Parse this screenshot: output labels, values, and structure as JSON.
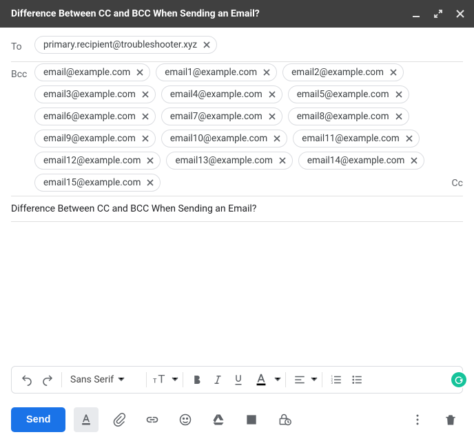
{
  "window": {
    "title": "Difference Between CC and BCC When Sending an Email?"
  },
  "to": {
    "label": "To",
    "recipients": [
      "primary.recipient@troubleshooter.xyz"
    ]
  },
  "bcc": {
    "label": "Bcc",
    "recipients": [
      "email@example.com",
      "email1@example.com",
      "email2@example.com",
      "email3@example.com",
      "email4@example.com",
      "email5@example.com",
      "email6@example.com",
      "email7@example.com",
      "email8@example.com",
      "email9@example.com",
      "email10@example.com",
      "email11@example.com",
      "email12@example.com",
      "email13@example.com",
      "email14@example.com",
      "email15@example.com"
    ]
  },
  "cc_toggle_label": "Cc",
  "subject": "Difference Between CC and BCC When Sending an Email?",
  "format_toolbar": {
    "font_family": "Sans Serif"
  },
  "actions": {
    "send_label": "Send"
  }
}
